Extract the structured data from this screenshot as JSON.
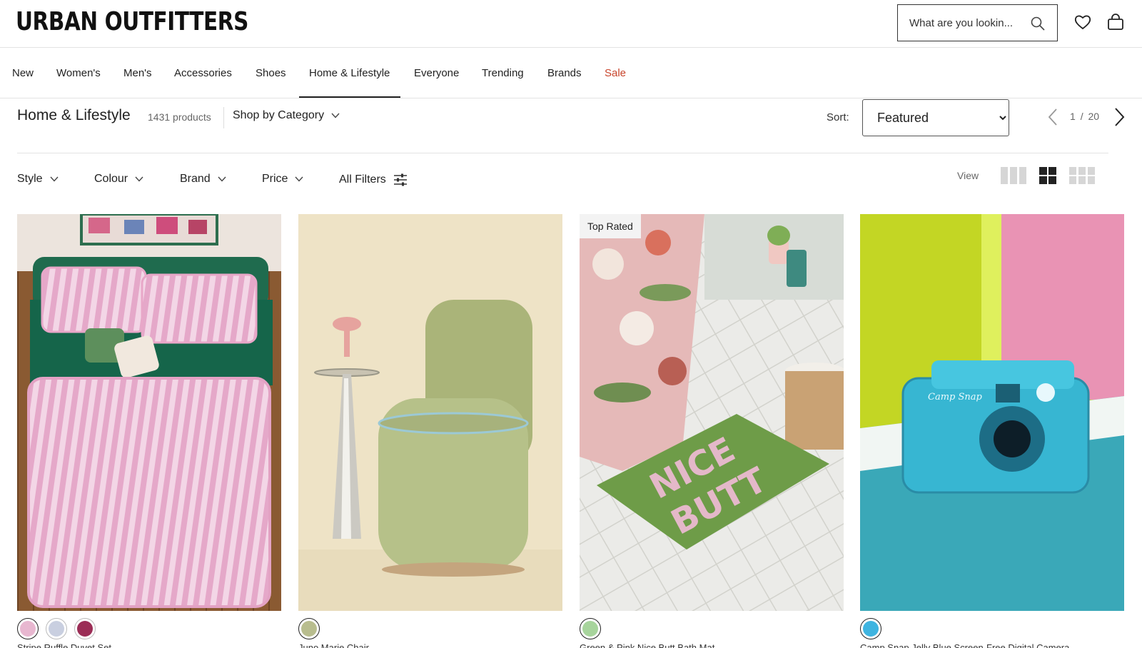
{
  "header": {
    "logo": "URBAN OUTFITTERS",
    "search_placeholder": "What are you lookin...",
    "icons": [
      "search-icon",
      "heart-icon",
      "shopping-bag-icon"
    ]
  },
  "nav": {
    "items": [
      {
        "label": "New"
      },
      {
        "label": "Women's"
      },
      {
        "label": "Men's"
      },
      {
        "label": "Accessories"
      },
      {
        "label": "Shoes"
      },
      {
        "label": "Home & Lifestyle",
        "active": true
      },
      {
        "label": "Everyone"
      },
      {
        "label": "Trending"
      },
      {
        "label": "Brands"
      },
      {
        "label": "Sale",
        "color": "#c8452c"
      }
    ]
  },
  "listing": {
    "title": "Home & Lifestyle",
    "count": "1431 products",
    "category_dropdown": "Shop by Category",
    "sort_label": "Sort:",
    "sort_value": "Featured",
    "pagination": {
      "current": "1",
      "separator": "/",
      "total": "20"
    }
  },
  "filters": {
    "items": [
      {
        "label": "Style"
      },
      {
        "label": "Colour"
      },
      {
        "label": "Brand"
      },
      {
        "label": "Price"
      },
      {
        "label": "All Filters"
      }
    ],
    "view_label": "View",
    "view_options": [
      "three-column-view-icon",
      "two-by-two-view-icon",
      "grid-view-icon"
    ],
    "active_view": "two-by-two-view-icon"
  },
  "products": [
    {
      "badge": "",
      "swatches": [
        "#e8b7d0",
        "#c9cfe0",
        "#9b2d56"
      ],
      "name": "Stripe Ruffle Duvet Set"
    },
    {
      "badge": "",
      "swatches": [
        "#b8bd8e"
      ],
      "name": "Juno Marie Chair"
    },
    {
      "badge": "Top Rated",
      "swatches": [
        "#a7d49c"
      ],
      "name": "Green & Pink Nice Butt Bath Mat"
    },
    {
      "badge": "",
      "swatches": [
        "#3fb4e0"
      ],
      "name": "Camp Snap Jelly Blue Screen-Free Digital Camera"
    }
  ]
}
